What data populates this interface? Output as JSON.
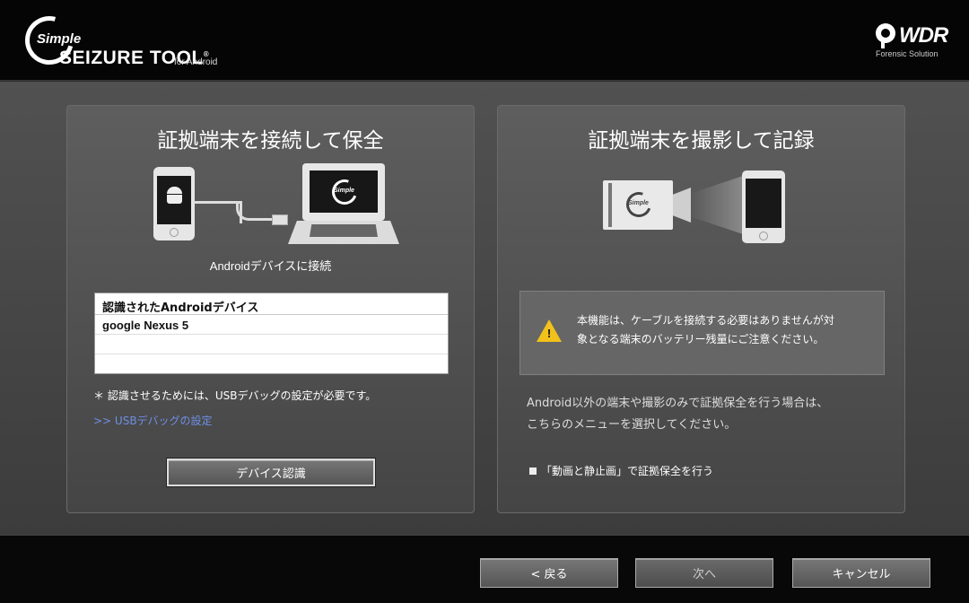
{
  "header": {
    "logo_simple": "Simple",
    "logo_main": "SEIZURE TOOL",
    "logo_registered": "®",
    "logo_for": "for Android",
    "brand_name": "WDR",
    "brand_sub": "Forensic Solution"
  },
  "left_panel": {
    "title": "証拠端末を接続して保全",
    "caption": "Androidデバイスに接続",
    "laptop_logo_text": "Simple",
    "table": {
      "header": "認識されたAndroidデバイス",
      "rows": [
        "google Nexus 5",
        "",
        ""
      ]
    },
    "usb_note": "＊ 認識させるためには、USBデバッグの設定が必要です。",
    "usb_link": ">> USBデバッグの設定",
    "detect_button": "デバイス認識"
  },
  "right_panel": {
    "title": "証拠端末を撮影して記録",
    "camera_logo_text": "Simple",
    "warning_mark": "!",
    "warning_line1": "本機能は、ケーブルを接続する必要はありませんが対",
    "warning_line2": "象となる端末のバッテリー残量にご注意ください。",
    "desc_line1": "Android以外の端末や撮影のみで証拠保全を行う場合は、",
    "desc_line2": "こちらのメニューを選択してください。",
    "media_link": "「動画と静止画」で証拠保全を行う"
  },
  "footer": {
    "back_label": "< 戻る",
    "next_label": "次へ",
    "cancel_label": "キャンセル"
  },
  "colors": {
    "warning": "#f1c21b",
    "link": "#6e8fe6",
    "background": "#2b2b2b"
  }
}
